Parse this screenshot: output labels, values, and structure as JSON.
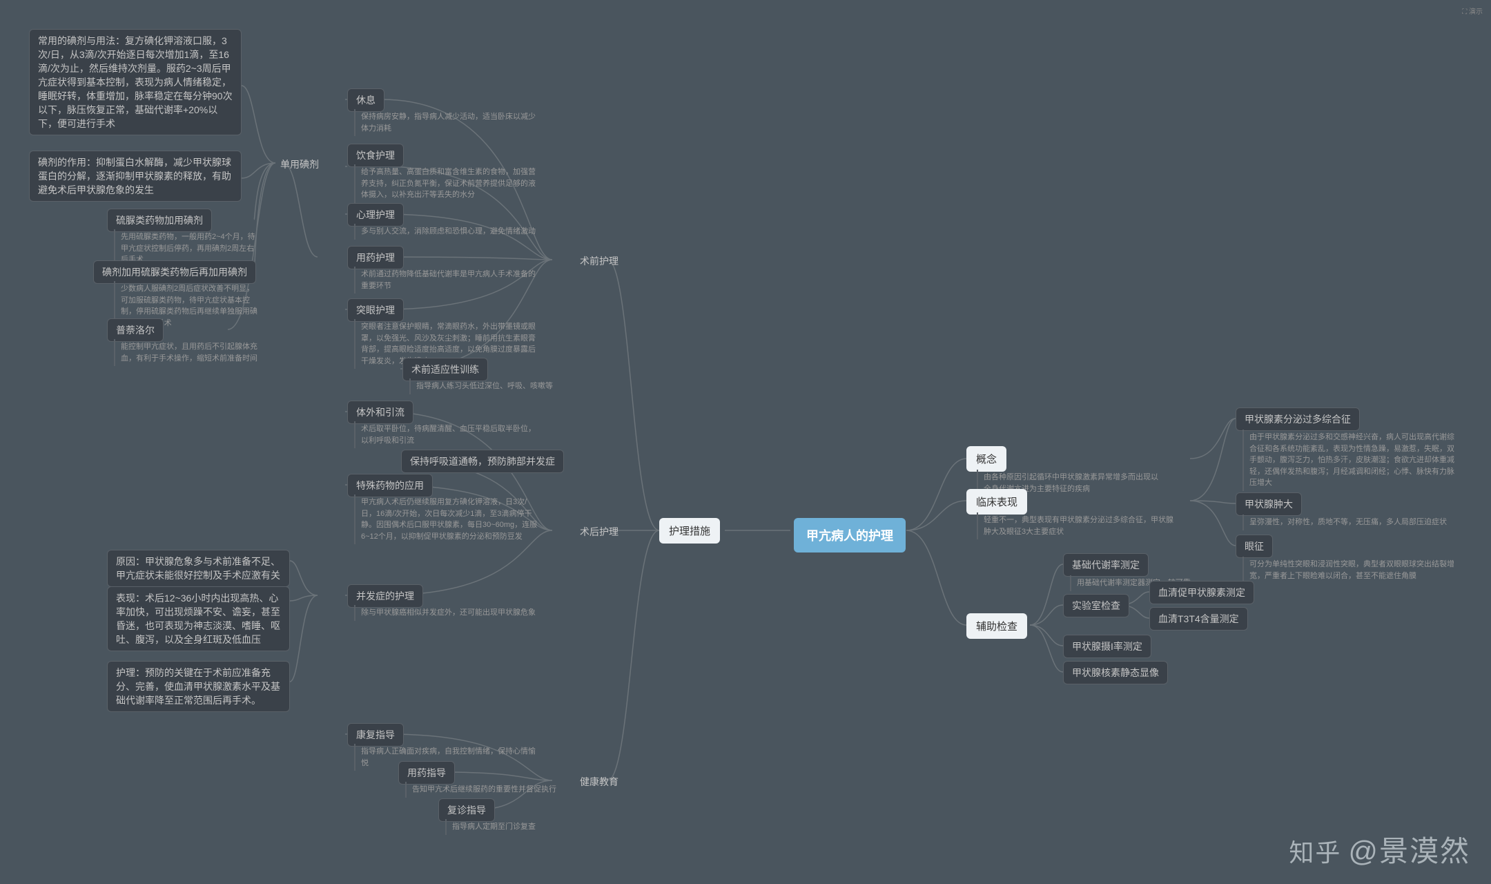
{
  "root": "甲亢病人的护理",
  "right": {
    "b1": "概念",
    "b1d": "由各种原因引起循环中甲状腺激素异常增多而出现以全身代谢亢进为主要特征的疾病",
    "b2": "临床表现",
    "b2d": "轻重不一，典型表现有甲状腺素分泌过多综合征，甲状腺肿大及眼征3大主要症状",
    "b2_1": "甲状腺素分泌过多综合征",
    "b2_1d": "由于甲状腺素分泌过多和交感神经兴奋，病人可出现高代谢综合征和各系统功能紊乱，表现为性情急躁，易激惹，失眠，双手颤动，腹泻乏力，怕热多汗，皮肤潮湿；食欲亢进却体重减轻，还偶伴发热和腹泻；月经减调和闭经；心悸、脉快有力脉压增大",
    "b2_2": "甲状腺肿大",
    "b2_2d": "呈弥漫性，对称性，质地不等，无压痛，多人局部压迫症状",
    "b2_3": "眼征",
    "b2_3d": "可分为单纯性突眼和浸润性突眼，典型者双眼眼球突出结裂增宽，严重者上下眼睑难以闭合，甚至不能遮住角膜",
    "b3": "辅助检查",
    "b3_1": "基础代谢率测定",
    "b3_1d": "用基础代谢率测定器测定，较可靠",
    "b3_2": "实验室检查",
    "b3_2a": "血清促甲状腺素测定",
    "b3_2b": "血清T3T4含量测定",
    "b3_3": "甲状腺摄I率测定",
    "b3_4": "甲状腺核素静态显像"
  },
  "left": {
    "b4": "护理措施",
    "s1": "术前护理",
    "s1_1": "休息",
    "s1_1d": "保持病房安静，指导病人减少活动，适当卧床以减少体力消耗",
    "s1_2": "饮食护理",
    "s1_2d": "给予高热量、高蛋白质和富含维生素的食物，加强营养支持，纠正负氮平衡，保证术前营养提供足够的液体摄入，以补充出汗等丢失的水分",
    "s1_3": "心理护理",
    "s1_3d": "多与别人交流，消除顾虑和恐惧心理，避免情绪激动",
    "s1_4": "用药护理",
    "s1_4d": "术前通过药物降低基础代谢率是甲亢病人手术准备的重要环节",
    "s1_4a": "单用碘剂",
    "s1_4a1": "常用的碘剂与用法：复方碘化钾溶液口服，3次/日，从3滴/次开始逐日每次增加1滴，至16滴/次为止，然后维持次剂量。服药2~3周后甲亢症状得到基本控制，表现为病人情绪稳定，睡眠好转，体重增加，脉率稳定在每分钟90次以下，脉压恢复正常，基础代谢率+20%以下，便可进行手术",
    "s1_4a2": "碘剂的作用：抑制蛋白水解酶，减少甲状腺球蛋白的分解，逐渐抑制甲状腺素的释放，有助避免术后甲状腺危象的发生",
    "s1_4b": "硫脲类药物加用碘剂",
    "s1_4bd": "先用硫脲类药物，一般用药2~4个月，待甲亢症状控制后停药，再用碘剂2周左右后手术",
    "s1_4c": "碘剂加用硫脲类药物后再加用碘剂",
    "s1_4cd": "少数病人服碘剂2周后症状改善不明显，可加服硫脲类药物，待甲亢症状基本控制，停用硫脲类药物后再继续单独服用碘剂1~2周后手术",
    "s1_4e": "普萘洛尔",
    "s1_4ed": "能控制甲亢症状，且用药后不引起腺体充血，有利于手术操作，缩短术前准备时间",
    "s1_5": "突眼护理",
    "s1_5d": "突眼者注意保护眼睛，常滴眼药水，外出带墨镜或眼罩，以免强光、风沙及灰尘刺激；睡前用抗生素眼膏背部，提高眼睑适度抬高适度，以免角膜过度暴露后干燥发炎，发生溃疡",
    "s1_6": "术前适应性训练",
    "s1_6d": "指导病人练习头低过深位、呼吸、咳嗽等",
    "s2": "术后护理",
    "s2_1": "体外和引流",
    "s2_1d": "术后取平卧位，待病醒清醒、血压平稳后取半卧位，以利呼吸和引流",
    "s2_2": "保持呼吸道通畅，预防肺部并发症",
    "s2_3": "特殊药物的应用",
    "s2_3d": "甲亢病人术后仍继续服用复方碘化钾溶液，日3次/日，16滴/次开始，次日每次减少1滴，至3滴病停干静。因围偶术后口服甲状腺素，每日30~60mg，连服6~12个月，以抑制促甲状腺素的分泌和预防豆发",
    "s2_4": "并发症的护理",
    "s2_4d": "除与甲状腺癌相似并发症外，还可能出现甲状腺危象",
    "s2_4a": "原因：甲状腺危象多与术前准备不足、甲亢症状未能很好控制及手术应激有关",
    "s2_4b": "表现：术后12~36小时内出现高热、心率加快，可出现烦躁不安、谵妄，甚至昏迷，也可表现为神志淡漠、嗜睡、呕吐、腹泻，以及全身红斑及低血压",
    "s2_4c": "护理：预防的关键在于术前应准备充分、完善，使血清甲状腺激素水平及基础代谢率降至正常范围后再手术。",
    "s3": "健康教育",
    "s3_1": "康复指导",
    "s3_1d": "指导病人正确面对疾病，自我控制情绪，保持心情愉悦",
    "s3_2": "用药指导",
    "s3_2d": "告知甲亢术后继续服药的重要性并督促执行",
    "s3_3": "复诊指导",
    "s3_3d": "指导病人定期至门诊复查"
  },
  "topicon": "⛶ 演示",
  "watermark": "知乎 @景漠然"
}
